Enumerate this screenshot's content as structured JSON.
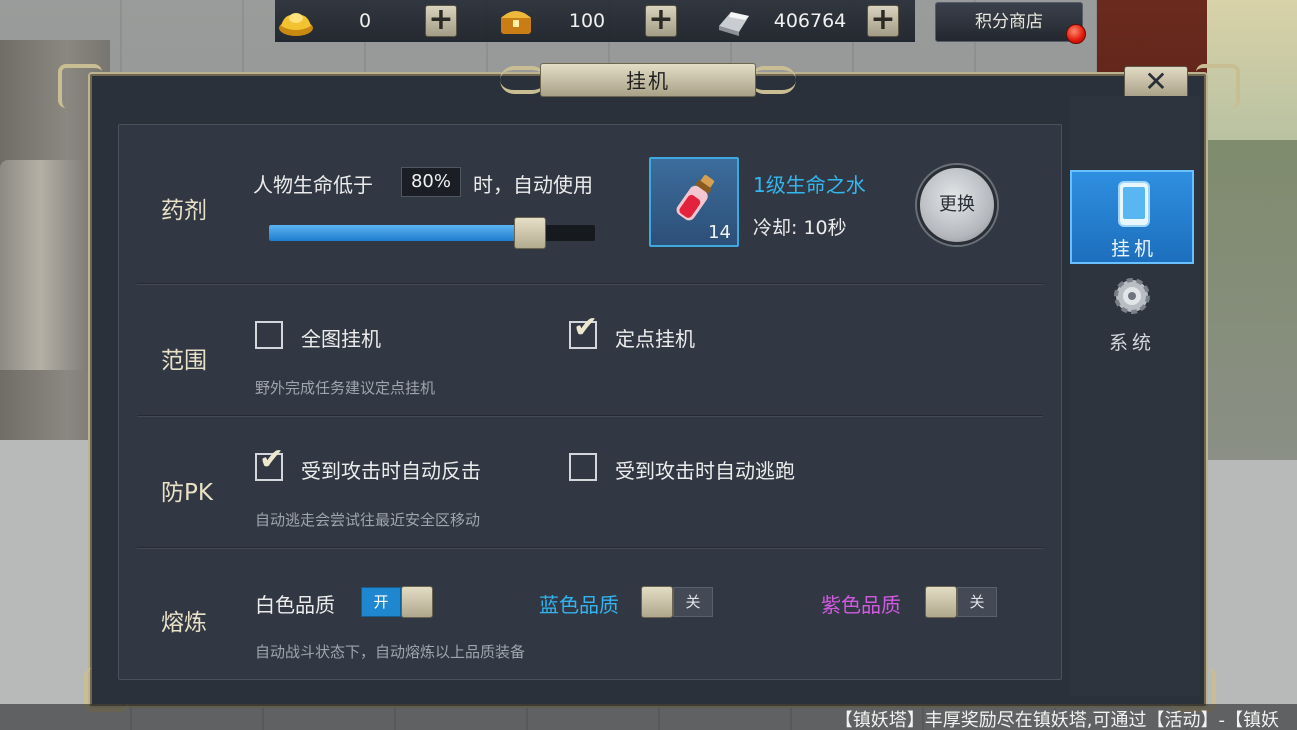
{
  "window": {
    "title": "挂机"
  },
  "currencies": [
    {
      "icon": "gold-ingot-icon",
      "value": "0"
    },
    {
      "icon": "treasure-chest-icon",
      "value": "100"
    },
    {
      "icon": "silver-ingot-icon",
      "value": "406764"
    }
  ],
  "shop": {
    "label": "积分商店",
    "has_notification": true
  },
  "potion": {
    "section_label": "药剂",
    "prefix_text": "人物生命低于",
    "threshold": "80%",
    "threshold_fraction": 0.8,
    "suffix_text": "时，自动使用",
    "item_name": "1级生命之水",
    "item_count": "14",
    "cooldown": "冷却: 10秒",
    "swap_label": "更换"
  },
  "range": {
    "section_label": "范围",
    "option_full_map": {
      "label": "全图挂机",
      "checked": false
    },
    "option_fixed_point": {
      "label": "定点挂机",
      "checked": true
    },
    "hint": "野外完成任务建议定点挂机"
  },
  "anti_pk": {
    "section_label": "防PK",
    "option_counter": {
      "label": "受到攻击时自动反击",
      "checked": true
    },
    "option_flee": {
      "label": "受到攻击时自动逃跑",
      "checked": false
    },
    "hint": "自动逃走会尝试往最近安全区移动"
  },
  "smelt": {
    "section_label": "熔炼",
    "white": {
      "label": "白色品质",
      "state": "开",
      "on": true,
      "color": "#ececec"
    },
    "blue": {
      "label": "蓝色品质",
      "state": "关",
      "on": false,
      "color": "#33b3ef"
    },
    "purple": {
      "label": "紫色品质",
      "state": "关",
      "on": false,
      "color": "#d05ae0"
    },
    "hint": "自动战斗状态下，自动熔炼以上品质装备"
  },
  "side_tabs": [
    {
      "label": "挂机",
      "icon": "tablet-icon",
      "active": true
    },
    {
      "label": "系统",
      "icon": "gear-icon",
      "active": false
    }
  ],
  "ticker": {
    "text": "【镇妖塔】丰厚奖励尽在镇妖塔,可通过【活动】-【镇妖"
  },
  "colors": {
    "accent_blue": "#1f86d0",
    "item_name": "#34b6ef",
    "frame_gold": "#c9bd93"
  }
}
